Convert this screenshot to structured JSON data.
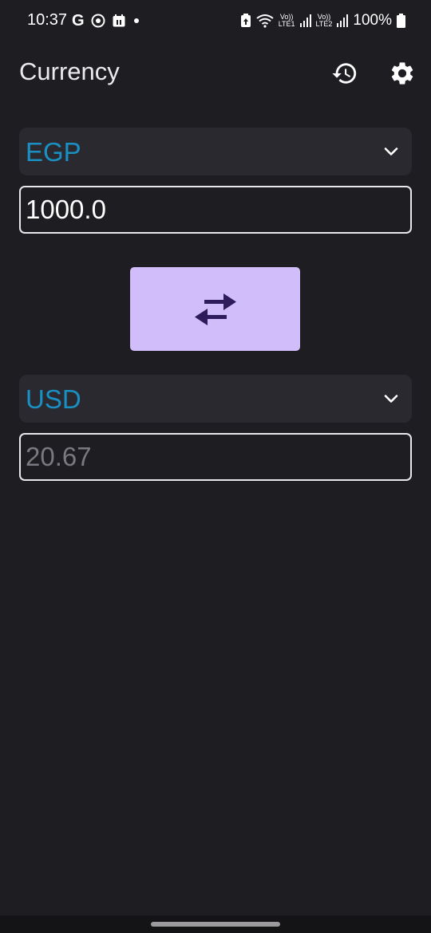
{
  "status_bar": {
    "time": "10:37",
    "left_icons": [
      "google-icon",
      "circle-sync-icon",
      "calendar-icon",
      "notification-dot-icon"
    ],
    "sim1_label_top": "Vo))",
    "sim1_label_bottom": "LTE1",
    "sim2_label_top": "Vo))",
    "sim2_label_bottom": "LTE2",
    "battery": "100%"
  },
  "appbar": {
    "title": "Currency",
    "actions": [
      "history-icon",
      "settings-icon"
    ]
  },
  "converter": {
    "from_currency": "EGP",
    "from_amount": "1000.0",
    "swap_icon": "swap-arrows-icon",
    "to_currency": "USD",
    "to_amount": "20.67"
  },
  "colors": {
    "background": "#1e1d21",
    "dropdown_bg": "#2a2930",
    "accent_text": "#1a8fc2",
    "swap_button": "#d2bdfb",
    "swap_icon": "#2e1b5c"
  }
}
